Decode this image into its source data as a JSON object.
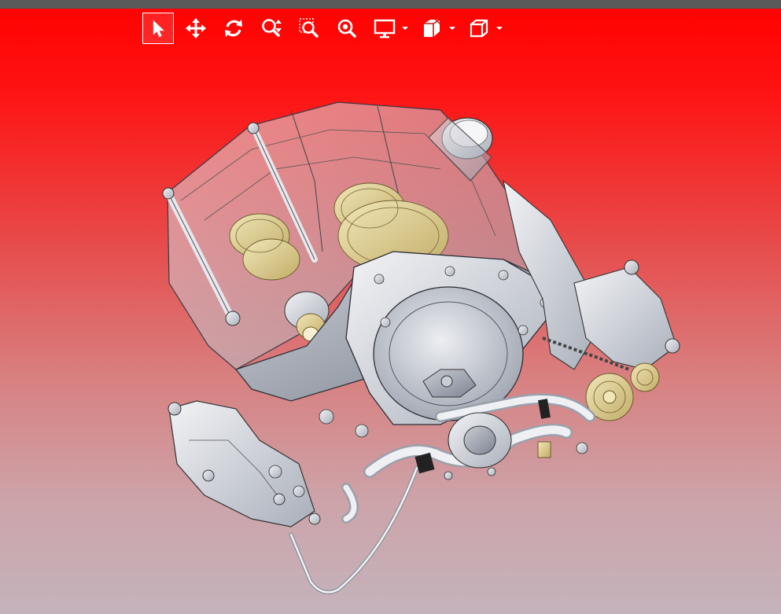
{
  "app": {
    "viewer": "cad-3d-viewer"
  },
  "toolbar": {
    "items": [
      {
        "name": "select",
        "icon": "cursor-arrow-icon",
        "active": true
      },
      {
        "name": "pan",
        "icon": "move-arrows-icon",
        "active": false
      },
      {
        "name": "rotate",
        "icon": "rotate-icon",
        "active": false
      },
      {
        "name": "zoom",
        "icon": "zoom-icon",
        "active": false
      },
      {
        "name": "zoom-window",
        "icon": "zoom-window-icon",
        "active": false
      },
      {
        "name": "zoom-fit",
        "icon": "zoom-fit-icon",
        "active": false
      },
      {
        "name": "display-mode",
        "icon": "monitor-icon",
        "has_dropdown": true
      },
      {
        "name": "section-view",
        "icon": "section-box-icon",
        "has_dropdown": true
      },
      {
        "name": "standard-views",
        "icon": "cube-icon",
        "has_dropdown": true
      }
    ]
  },
  "colors": {
    "background_top": "#ff0000",
    "background_bottom": "#c5b3bb",
    "topbar": "#5a5a5a",
    "icon": "#ffffff",
    "model_metal": "#d9dde4",
    "model_brass": "#e6d9a0",
    "model_housing": "#b9bfca"
  },
  "model": {
    "icon": "engine-3d-model"
  }
}
